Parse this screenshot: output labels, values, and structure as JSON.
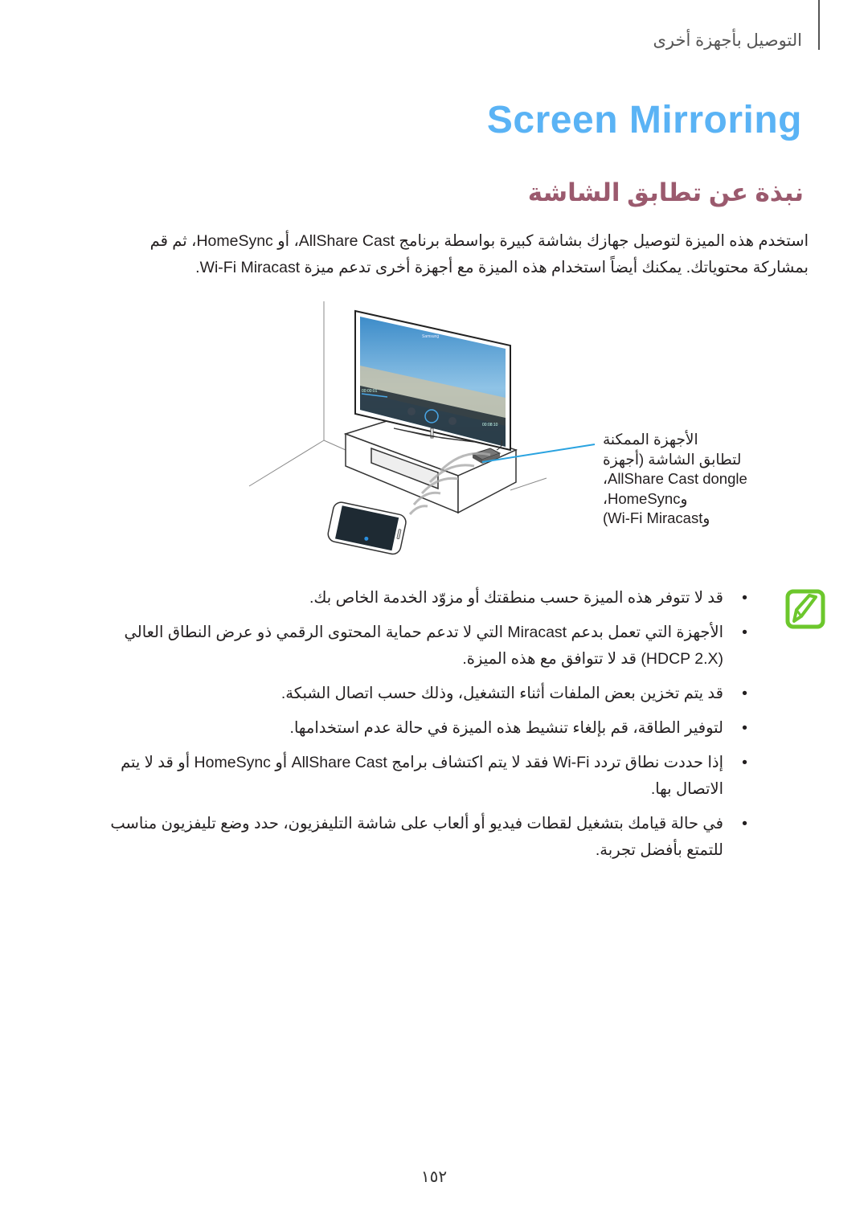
{
  "header": {
    "section_title": "التوصيل بأجهزة أخرى"
  },
  "page_title": "Screen Mirroring",
  "subheading": "نبذة عن تطابق الشاشة",
  "intro": {
    "line1": "استخدم هذه الميزة لتوصيل جهازك بشاشة كبيرة بواسطة برنامج AllShare Cast، أو HomeSync، ثم قم",
    "line2": "بمشاركة محتوياتك. يمكنك أيضاً استخدام هذه الميزة مع أجهزة أخرى تدعم ميزة Wi-Fi Miracast."
  },
  "figure": {
    "tv_screen_label": "Samsung",
    "tv_time_elapsed": "00:00:01",
    "tv_time_total": "00:08:10",
    "callout_lines": [
      "الأجهزة الممكنة",
      "لتطابق الشاشة (أجهزة",
      "AllShare Cast dongle،",
      "وHomeSync،",
      "وWi-Fi Miracast)"
    ]
  },
  "notes": {
    "icon": "note-pencil-icon",
    "bullet": "•",
    "items": [
      "قد لا تتوفر هذه الميزة حسب منطقتك أو مزوّد الخدمة الخاص بك.",
      "الأجهزة التي تعمل بدعم Miracast التي لا تدعم حماية المحتوى الرقمي ذو عرض النطاق العالي (HDCP 2.X) قد لا تتوافق مع هذه الميزة.",
      "قد يتم تخزين بعض الملفات أثناء التشغيل، وذلك حسب اتصال الشبكة.",
      "لتوفير الطاقة، قم بإلغاء تنشيط هذه الميزة في حالة عدم استخدامها.",
      "إذا حددت نطاق تردد Wi-Fi فقد لا يتم اكتشاف برامج AllShare Cast أو HomeSync أو قد لا يتم الاتصال بها.",
      "في حالة قيامك بتشغيل لقطات فيديو أو ألعاب على شاشة التليفزيون، حدد وضع تليفزيون مناسب للتمتع بأفضل تجربة."
    ]
  },
  "colors": {
    "title_blue": "#5ab3f5",
    "subheading_mauve": "#9b5a6e",
    "note_green": "#6cc72c",
    "callout_line_blue": "#2aa3e0"
  },
  "page_number": "١٥٢"
}
